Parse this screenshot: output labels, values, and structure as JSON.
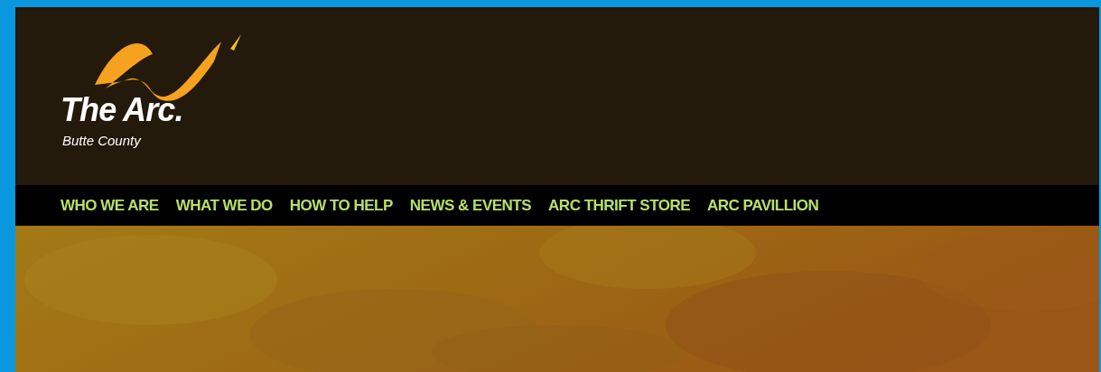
{
  "logo": {
    "title": "The Arc.",
    "subtitle": "Butte County"
  },
  "nav": {
    "items": [
      {
        "label": "WHO WE ARE"
      },
      {
        "label": "WHAT WE DO"
      },
      {
        "label": "HOW TO HELP"
      },
      {
        "label": "NEWS & EVENTS"
      },
      {
        "label": "ARC THRIFT STORE"
      },
      {
        "label": "ARC PAVILLION"
      }
    ]
  }
}
